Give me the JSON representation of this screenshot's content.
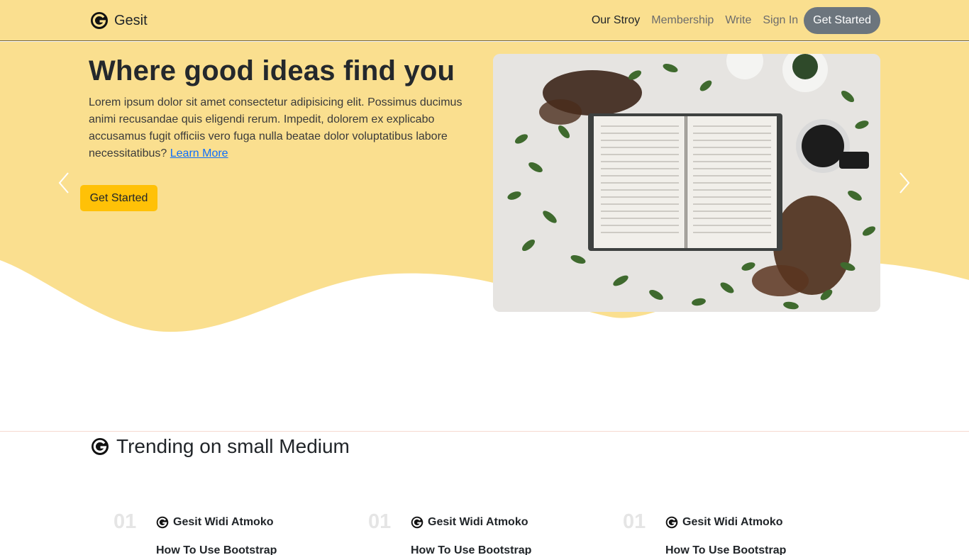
{
  "brand": {
    "name": "Gesit",
    "logo_icon": "g-logo-icon"
  },
  "nav": {
    "links": [
      "Our Stroy",
      "Membership",
      "Write",
      "Sign In"
    ],
    "cta": "Get Started"
  },
  "hero": {
    "title": "Where good ideas find you",
    "body": "Lorem ipsum dolor sit amet consectetur adipisicing elit. Possimus ducimus animi recusandae quis eligendi rerum. Impedit, dolorem ex explicabo accusamus fugit officiis vero fuga nulla beatae dolor voluptatibus labore necessitatibus?",
    "link": "Learn More",
    "button": "Get Started",
    "bg_color": "#fadf8f",
    "button_color": "#ffc107"
  },
  "trending": {
    "title": "Trending on small Medium",
    "cards": [
      {
        "num": "01",
        "author": "Gesit Widi Atmoko",
        "post": "How To Use Bootstrap"
      },
      {
        "num": "01",
        "author": "Gesit Widi Atmoko",
        "post": "How To Use Bootstrap"
      },
      {
        "num": "01",
        "author": "Gesit Widi Atmoko",
        "post": "How To Use Bootstrap"
      }
    ]
  }
}
